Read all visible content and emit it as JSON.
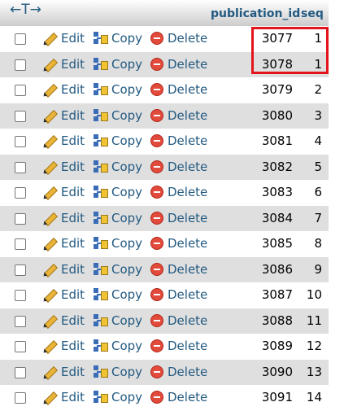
{
  "header": {
    "arrows": "←T→",
    "col_publication_id": "publication_id",
    "col_seq": "seq"
  },
  "actions": {
    "edit": "Edit",
    "copy": "Copy",
    "delete": "Delete"
  },
  "rows": [
    {
      "publication_id": "3077",
      "seq": "1"
    },
    {
      "publication_id": "3078",
      "seq": "1"
    },
    {
      "publication_id": "3079",
      "seq": "2"
    },
    {
      "publication_id": "3080",
      "seq": "3"
    },
    {
      "publication_id": "3081",
      "seq": "4"
    },
    {
      "publication_id": "3082",
      "seq": "5"
    },
    {
      "publication_id": "3083",
      "seq": "6"
    },
    {
      "publication_id": "3084",
      "seq": "7"
    },
    {
      "publication_id": "3085",
      "seq": "8"
    },
    {
      "publication_id": "3086",
      "seq": "9"
    },
    {
      "publication_id": "3087",
      "seq": "10"
    },
    {
      "publication_id": "3088",
      "seq": "11"
    },
    {
      "publication_id": "3089",
      "seq": "12"
    },
    {
      "publication_id": "3090",
      "seq": "13"
    },
    {
      "publication_id": "3091",
      "seq": "14"
    }
  ],
  "colors": {
    "link": "#235a81",
    "row_alt": "#dfdfdf",
    "highlight": "#e3141b"
  }
}
